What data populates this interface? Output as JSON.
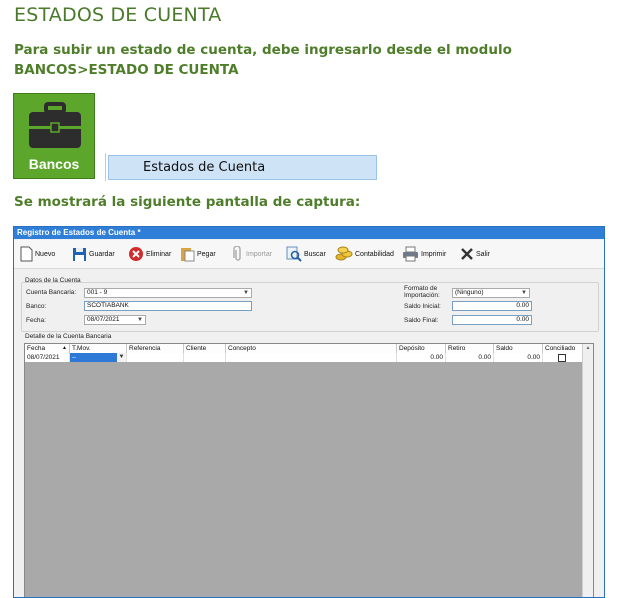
{
  "doc": {
    "title": "ESTADOS DE CUENTA",
    "intro": "Para subir un estado de cuenta, debe ingresarlo desde el modulo BANCOS>ESTADO DE CUENTA",
    "tile_label": "Bancos",
    "menu_item": "Estados de Cuenta",
    "capture_note": "Se mostrará la siguiente pantalla de captura:"
  },
  "window": {
    "title": "Registro de Estados de Cuenta *",
    "toolbar": {
      "nuevo": "Nuevo",
      "guardar": "Guardar",
      "eliminar": "Eliminar",
      "pegar": "Pegar",
      "importar": "Importar",
      "buscar": "Buscar",
      "contabilidad": "Contabilidad",
      "imprimir": "Imprimir",
      "salir": "Salir"
    },
    "datos": {
      "section": "Datos de la Cuenta",
      "cuenta_label": "Cuenta Bancaria:",
      "cuenta_value": "001 - 9",
      "banco_label": "Banco:",
      "banco_value": "SCOTIABANK",
      "fecha_label": "Fecha:",
      "fecha_value": "08/07/2021",
      "formato_label": "Formato de Importación:",
      "formato_value": "(Ninguno)",
      "saldo_inicial_label": "Saldo Inicial:",
      "saldo_inicial_value": "0.00",
      "saldo_final_label": "Saldo Final:",
      "saldo_final_value": "0.00"
    },
    "detalle": {
      "section": "Detalle de la Cuenta Bancaria",
      "columns": [
        "Fecha",
        "T.Mov.",
        "Referencia",
        "Cliente",
        "Concepto",
        "Depósito",
        "Retiro",
        "Saldo",
        "Conciliado"
      ],
      "row": {
        "fecha": "08/07/2021",
        "tmov": "--",
        "deposito": "0.00",
        "retiro": "0.00",
        "saldo": "0.00"
      }
    }
  }
}
